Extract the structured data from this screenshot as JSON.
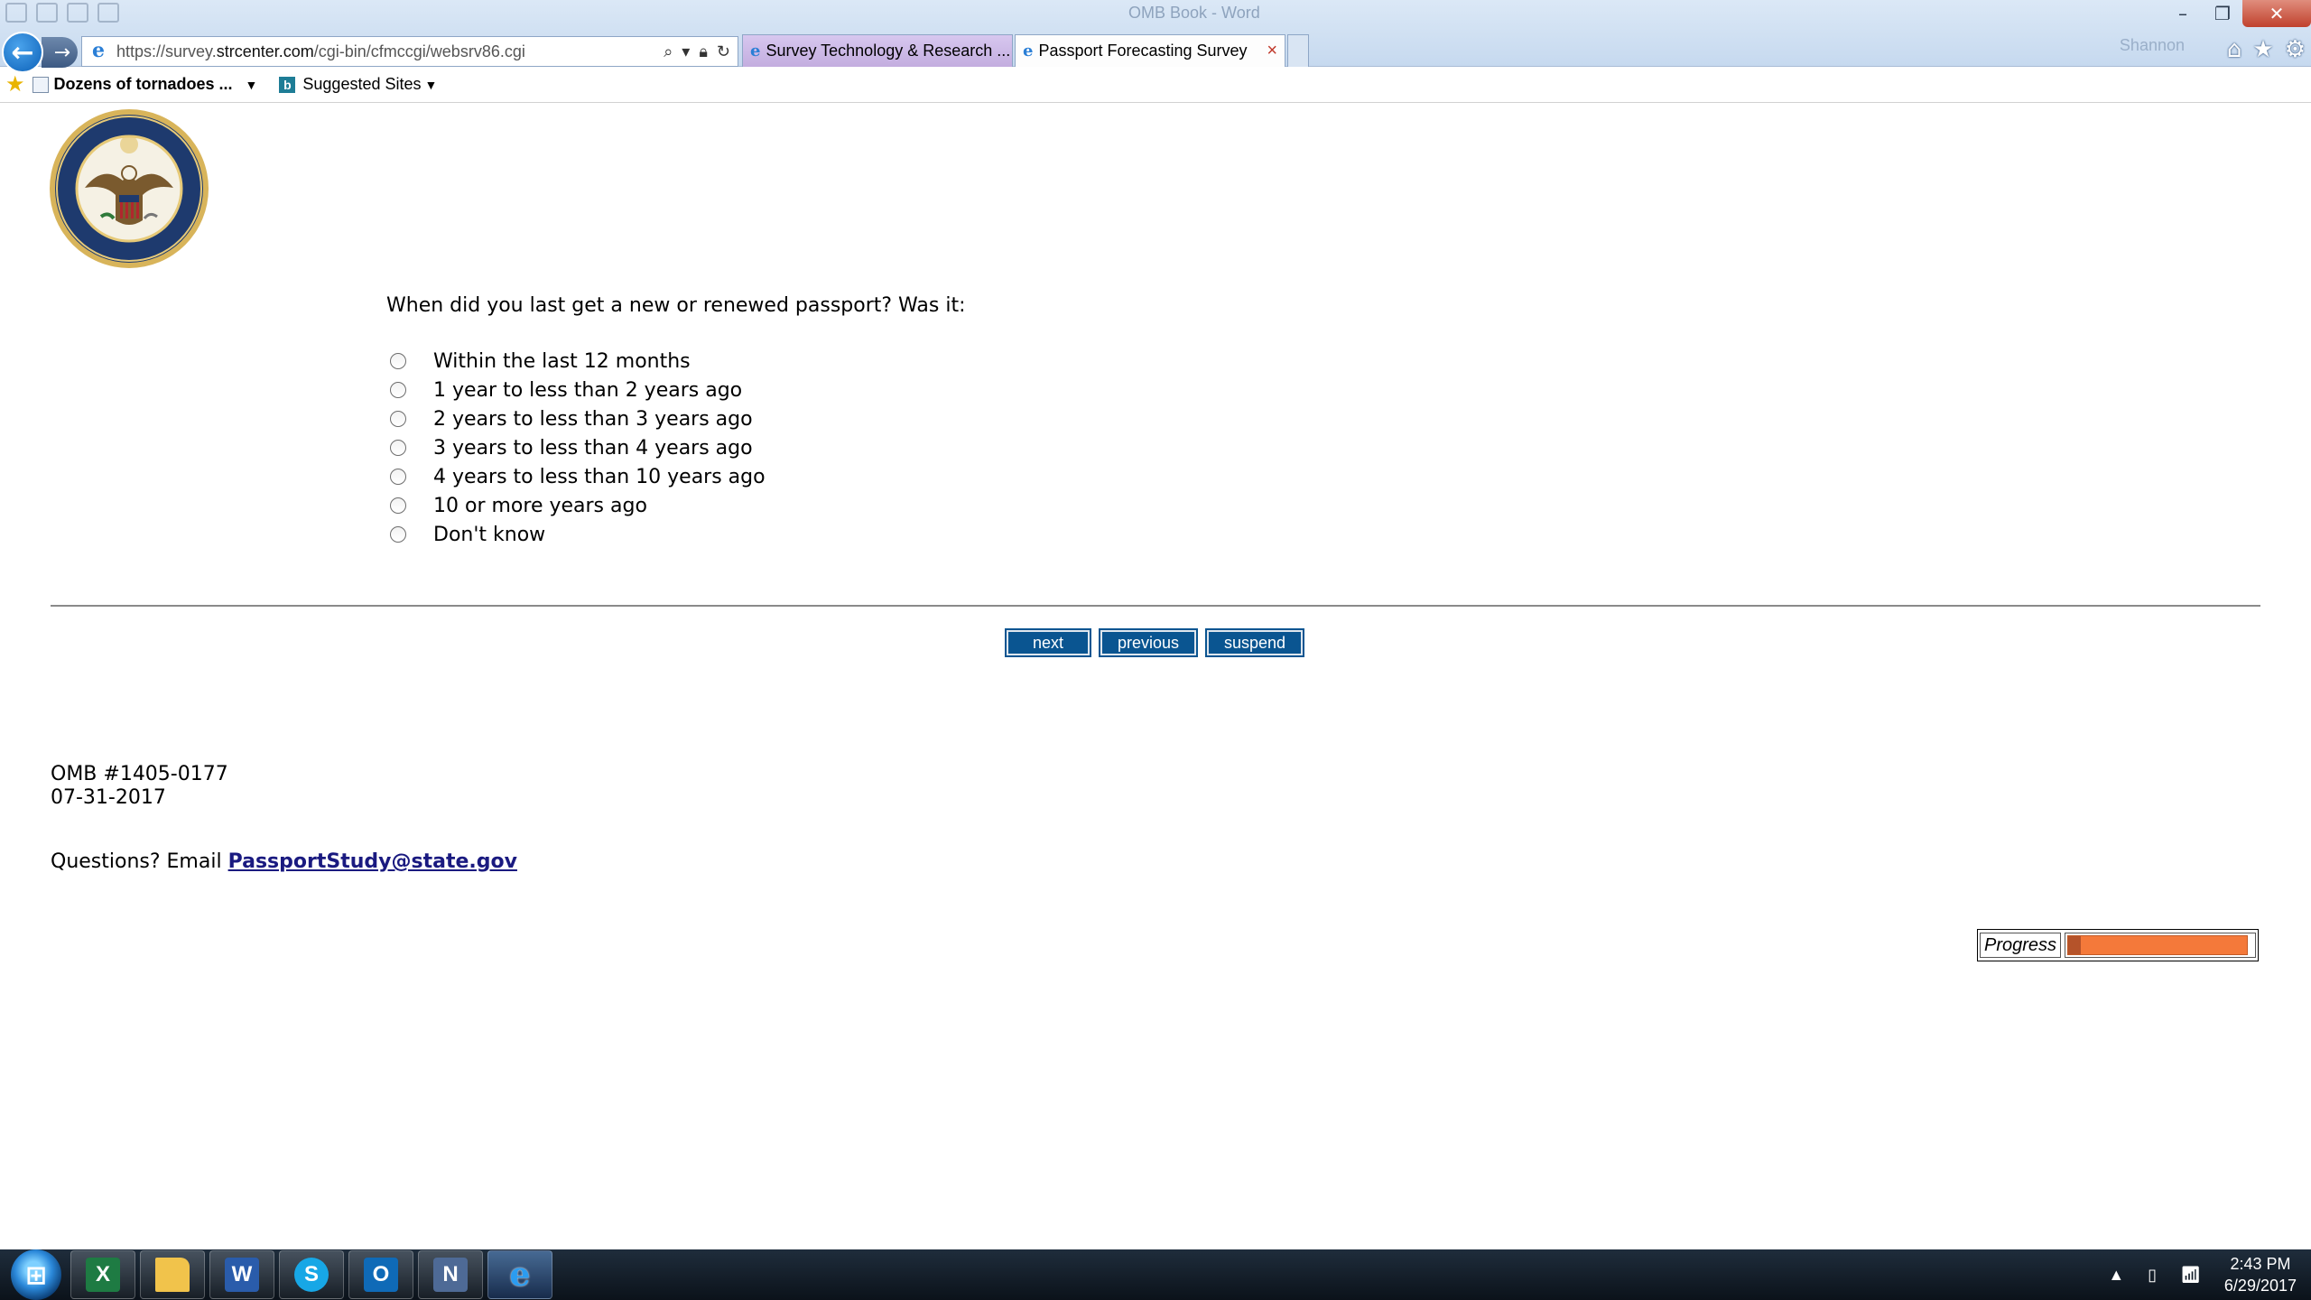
{
  "window": {
    "ghost_title": "OMB Book - Word",
    "ghost_user": "Shannon"
  },
  "browser": {
    "address": {
      "url_prefix": "https://survey.",
      "url_host": "strcenter.com",
      "url_path": "/cgi-bin/cfmccgi/websrv86.cgi"
    },
    "tabs": [
      {
        "label": "Survey Technology & Research ...",
        "active": false
      },
      {
        "label": "Passport Forecasting Survey",
        "active": true
      }
    ],
    "favorites": [
      {
        "label": "Dozens of tornadoes ..."
      },
      {
        "label": "Suggested Sites"
      }
    ]
  },
  "survey": {
    "question": "When did you last get a new or renewed passport? Was it:",
    "options": [
      "Within the last 12 months",
      "1 year to less than 2 years ago",
      "2 years to less than 3 years ago",
      "3 years to less than 4 years ago",
      "4 years to less than 10 years ago",
      "10 or more years ago",
      "Don't know"
    ],
    "buttons": {
      "next": "next",
      "previous": "previous",
      "suspend": "suspend"
    },
    "omb_number": "OMB #1405-0177",
    "omb_date": "07-31-2017",
    "questions_prefix": "Questions? Email",
    "email": "PassportStudy@state.gov",
    "progress_label": "Progress",
    "progress_fraction": 0.97
  },
  "taskbar": {
    "apps": [
      "excel-icon",
      "folder-icon",
      "word-icon",
      "skype-icon",
      "outlook-icon",
      "n-app-icon",
      "internet-explorer-icon"
    ],
    "time": "2:43 PM",
    "date": "6/29/2017"
  },
  "colors": {
    "button_bg": "#0a5591",
    "progress_fill": "#f4793a",
    "link": "#1a1a80"
  }
}
